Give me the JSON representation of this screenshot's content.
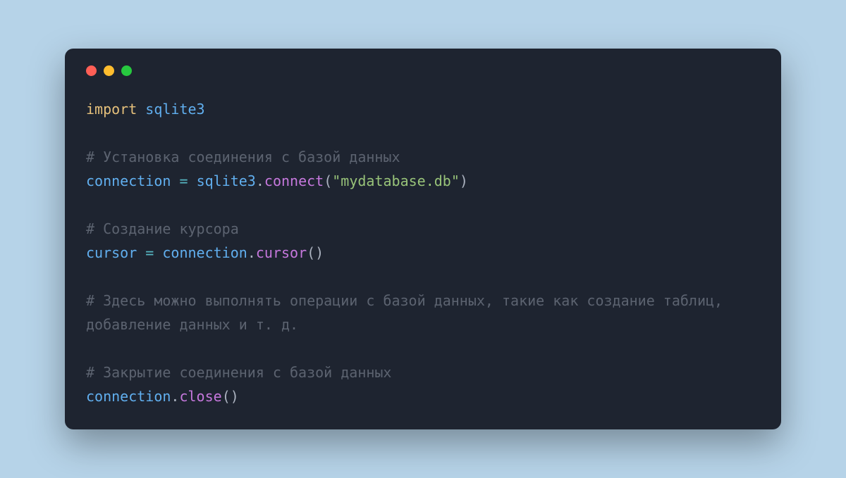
{
  "colors": {
    "background": "#b6d3e8",
    "window": "#1e2430",
    "close": "#ff5f56",
    "minimize": "#ffbd2e",
    "maximize": "#27c93f",
    "keyword": "#e5c07b",
    "module": "#61afef",
    "comment": "#5c6370",
    "variable": "#61afef",
    "operator": "#56b6c2",
    "punct": "#abb2bf",
    "func": "#c678dd",
    "string": "#98c379"
  },
  "code": {
    "l1": {
      "import": "import",
      "sp": " ",
      "module": "sqlite3"
    },
    "l3": {
      "comment": "# Установка соединения с базой данных"
    },
    "l4": {
      "var": "connection",
      "sp1": " ",
      "eq": "=",
      "sp2": " ",
      "mod": "sqlite3",
      "dot": ".",
      "fn": "connect",
      "lp": "(",
      "str": "\"mydatabase.db\"",
      "rp": ")"
    },
    "l6": {
      "comment": "# Создание курсора"
    },
    "l7": {
      "var": "cursor",
      "sp1": " ",
      "eq": "=",
      "sp2": " ",
      "obj": "connection",
      "dot": ".",
      "fn": "cursor",
      "lp": "(",
      "rp": ")"
    },
    "l9": {
      "comment": "# Здесь можно выполнять операции с базой данных, такие как создание таблиц, добавление данных и т. д."
    },
    "l11": {
      "comment": "# Закрытие соединения с базой данных"
    },
    "l12": {
      "obj": "connection",
      "dot": ".",
      "fn": "close",
      "lp": "(",
      "rp": ")"
    }
  }
}
